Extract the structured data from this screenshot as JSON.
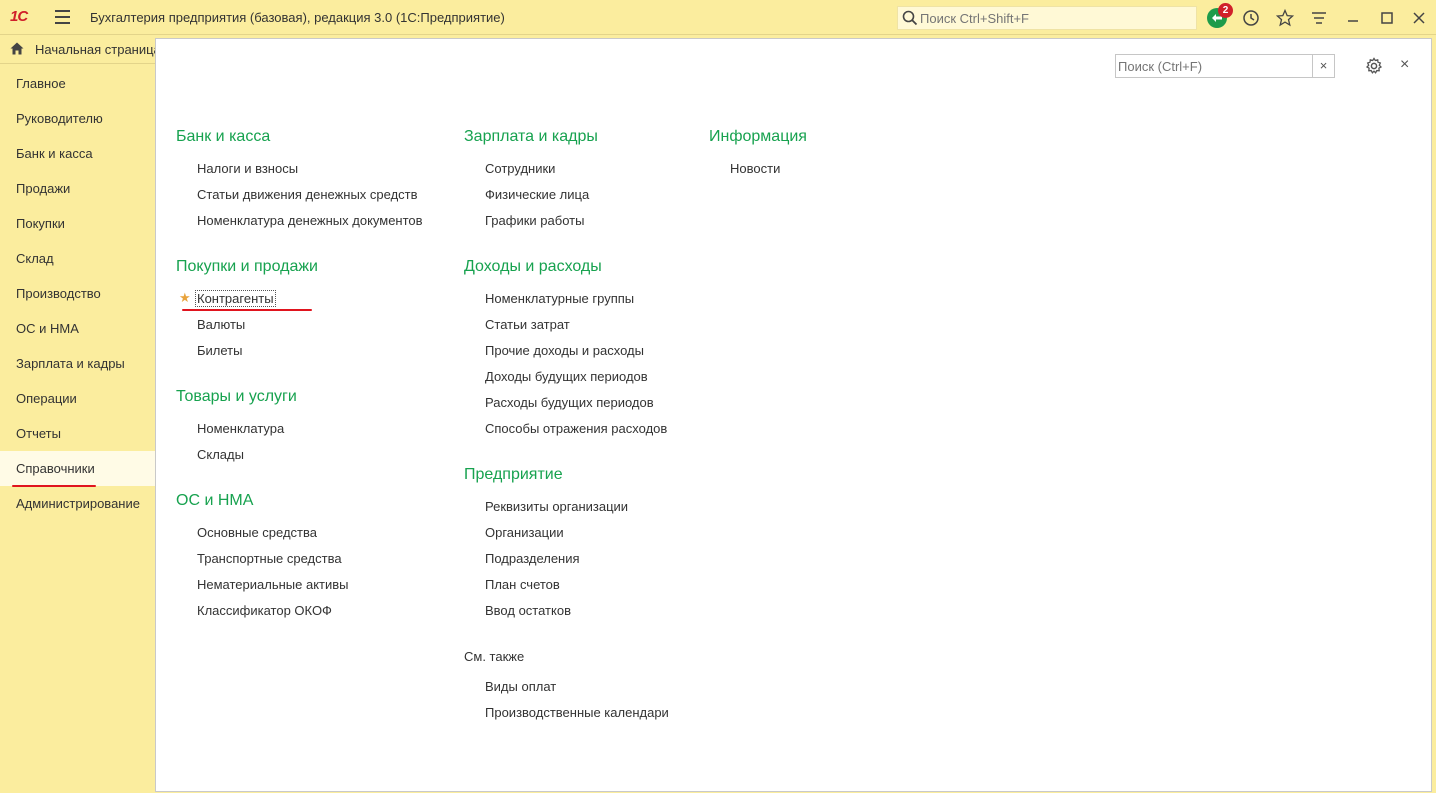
{
  "window": {
    "logo": "1С",
    "title": "Бухгалтерия предприятия (базовая), редакция 3.0  (1С:Предприятие)",
    "search_placeholder": "Поиск Ctrl+Shift+F",
    "notification_count": "2"
  },
  "home_tab": {
    "label": "Начальная страница"
  },
  "sidebar": {
    "items": [
      {
        "label": "Главное"
      },
      {
        "label": "Руководителю"
      },
      {
        "label": "Банк и касса"
      },
      {
        "label": "Продажи"
      },
      {
        "label": "Покупки"
      },
      {
        "label": "Склад"
      },
      {
        "label": "Производство"
      },
      {
        "label": "ОС и НМА"
      },
      {
        "label": "Зарплата и кадры"
      },
      {
        "label": "Операции"
      },
      {
        "label": "Отчеты"
      },
      {
        "label": "Справочники"
      },
      {
        "label": "Администрирование"
      }
    ],
    "active": "Справочники"
  },
  "panel": {
    "search_placeholder": "Поиск (Ctrl+F)",
    "clear_label": "×",
    "close_label": "×",
    "sections": {
      "bank": {
        "title": "Банк и касса",
        "links": [
          "Налоги и взносы",
          "Статьи движения денежных средств",
          "Номенклатура денежных документов"
        ]
      },
      "purchases_sales": {
        "title": "Покупки и продажи",
        "links": [
          "Контрагенты",
          "Валюты",
          "Билеты"
        ]
      },
      "goods": {
        "title": "Товары и услуги",
        "links": [
          "Номенклатура",
          "Склады"
        ]
      },
      "assets": {
        "title": "ОС и НМА",
        "links": [
          "Основные средства",
          "Транспортные средства",
          "Нематериальные активы",
          "Классификатор ОКОФ"
        ]
      },
      "salary": {
        "title": "Зарплата и кадры",
        "links": [
          "Сотрудники",
          "Физические лица",
          "Графики работы"
        ]
      },
      "income": {
        "title": "Доходы и расходы",
        "links": [
          "Номенклатурные группы",
          "Статьи затрат",
          "Прочие доходы и расходы",
          "Доходы будущих периодов",
          "Расходы будущих периодов",
          "Способы отражения расходов"
        ]
      },
      "enterprise": {
        "title": "Предприятие",
        "links": [
          "Реквизиты организации",
          "Организации",
          "Подразделения",
          "План счетов",
          "Ввод остатков"
        ]
      },
      "info": {
        "title": "Информация",
        "links": [
          "Новости"
        ]
      }
    },
    "see_also": {
      "title": "См. также",
      "links": [
        "Виды оплат",
        "Производственные календари"
      ]
    }
  },
  "colors": {
    "accent": "#17a24f",
    "sidebar_bg": "#fbed9e",
    "highlight": "#e0141e",
    "star": "#e8a33c"
  }
}
